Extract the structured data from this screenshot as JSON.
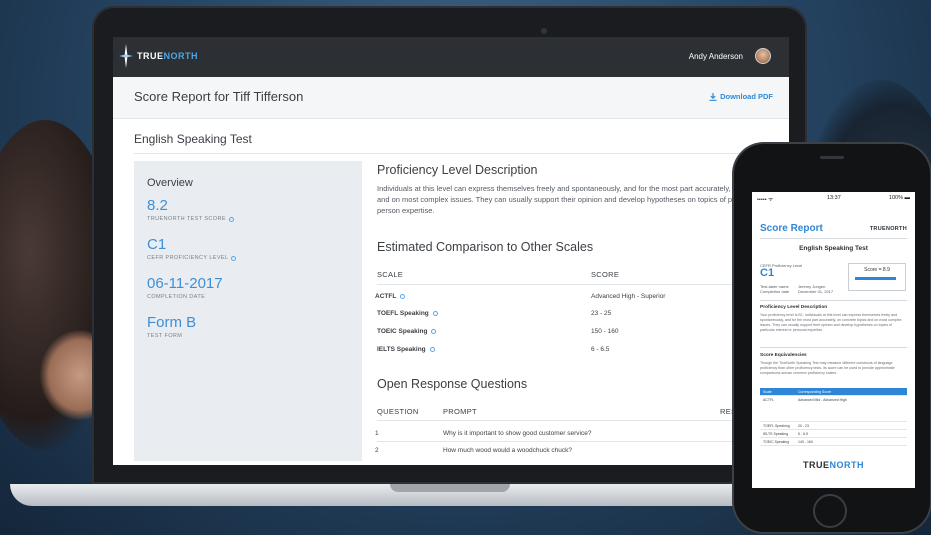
{
  "laptop": {
    "brand": {
      "part1": "TRUE",
      "part2": "NORTH"
    },
    "user_name": "Andy Anderson",
    "report_title": "Score Report for Tiff Tifferson",
    "download_label": "Download PDF",
    "test_title": "English Speaking Test",
    "overview": {
      "title": "Overview",
      "items": [
        {
          "value": "8.2",
          "label": "TRUENORTH TEST SCORE"
        },
        {
          "value": "C1",
          "label": "CEFR PROFICIENCY LEVEL"
        },
        {
          "value": "06-11-2017",
          "label": "COMPLETION DATE"
        },
        {
          "value": "Form B",
          "label": "TEST FORM"
        }
      ]
    },
    "proficiency": {
      "title": "Proficiency Level Description",
      "text": "Individuals at this level can express themselves freely and spontaneously, and for the most part accurately, on concrete topics and on most complex issues. They can usually support their opinion and develop hypotheses on topics of particular interest or person expertise."
    },
    "comparison": {
      "title": "Estimated Comparison to Other Scales",
      "headers": {
        "scale": "SCALE",
        "score": "SCORE"
      },
      "rows": [
        {
          "scale": "ACTFL",
          "score": "Advanced High - Superior"
        },
        {
          "scale": "TOEFL Speaking",
          "score": "23 - 25"
        },
        {
          "scale": "TOEIC Speaking",
          "score": "150 - 160"
        },
        {
          "scale": "IELTS Speaking",
          "score": "6 - 6.5"
        }
      ]
    },
    "open_response": {
      "title": "Open Response Questions",
      "headers": {
        "question": "QUESTION",
        "prompt": "PROMPT",
        "response": "RESPONSE"
      },
      "rows": [
        {
          "question": "1",
          "prompt": "Why is it important to show good customer service?"
        },
        {
          "question": "2",
          "prompt": "How much wood would a woodchuck chuck?"
        }
      ]
    }
  },
  "phone": {
    "status": {
      "left": "•••••  ᯤ",
      "time": "13:37",
      "battery": "100% ▬"
    },
    "title": "Score Report",
    "brand": "TRUENORTH",
    "test_title": "English Speaking Test",
    "cefr_label": "CEFR Proficiency Level",
    "cefr_value": "C1",
    "score_label": "Score = 8.9",
    "score_fraction": 0.89,
    "meta_labels": [
      "Test-taker name",
      "Completion date"
    ],
    "meta_values": [
      "Jeremy Jungen",
      "December 01, 2017"
    ],
    "proficiency_heading": "Proficiency Level Description",
    "proficiency_text": "Your proficiency level is B1. Individuals at this level can express themselves freely and spontaneously, and for the most part accurately, on concrete topics and on most complex issues. They can usually support their opinion and develop hypotheses on topics of particular interest or personal expertise.",
    "equivalencies_heading": "Score Equivalencies",
    "equivalencies_text": "Though the TrueNorth Speaking Test may measure different constructs of language proficiency than other proficiency tests, its score can be used to provide approximate comparisons across common proficiency scales.",
    "table_headers": [
      "Scale",
      "Corresponding Score"
    ],
    "table_rows": [
      {
        "scale": "ACTFL",
        "score": "Advanced Mid - Advanced High"
      },
      {
        "scale": "TOEFL Speaking",
        "score": "20 - 23"
      },
      {
        "scale": "IELTS Speaking",
        "score": "5 - 6.5"
      },
      {
        "scale": "TOEIC Speaking",
        "score": "140 - 160"
      }
    ],
    "logo": {
      "part1": "TRUE",
      "part2": "NORTH"
    }
  },
  "colors": {
    "accent": "#3e8fd6",
    "topbar": "#2c3035",
    "overview_bg": "#e9edf1"
  }
}
